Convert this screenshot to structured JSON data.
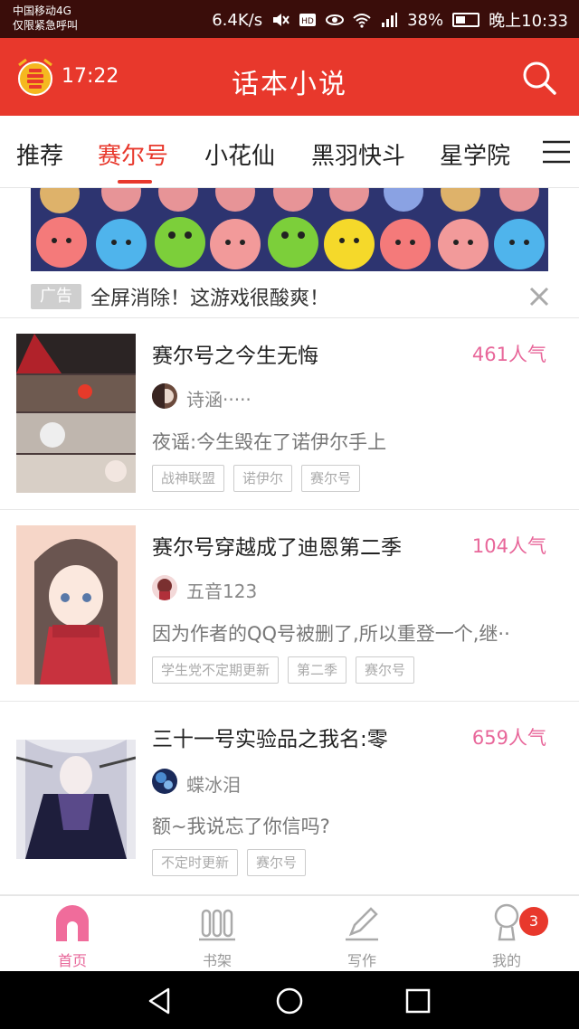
{
  "status_bar": {
    "carrier_line1": "中国移动4G",
    "carrier_line2": "仅限紧急呼叫",
    "net_speed": "6.4K/s",
    "battery": "38%",
    "time": "晚上10:33"
  },
  "header": {
    "timer": "17:22",
    "title": "话本小说",
    "bg_color": "#e8382c"
  },
  "tabs": [
    {
      "label": "推荐",
      "active": false
    },
    {
      "label": "赛尔号",
      "active": true
    },
    {
      "label": "小花仙",
      "active": false
    },
    {
      "label": "黑羽快斗",
      "active": false
    },
    {
      "label": "星学院",
      "active": false
    }
  ],
  "ad": {
    "badge": "广告",
    "text": "全屏消除！这游戏很酸爽！"
  },
  "books": [
    {
      "title": "赛尔号之今生无悔",
      "popularity": "461人气",
      "author": "诗涵·····",
      "description": "夜谣:今生毁在了诺伊尔手上",
      "tags": [
        "战神联盟",
        "诺伊尔",
        "赛尔号"
      ]
    },
    {
      "title": "赛尔号穿越成了迪恩第二季",
      "popularity": "104人气",
      "author": "五音123",
      "description": "因为作者的QQ号被删了,所以重登一个,继··",
      "tags": [
        "学生党不定期更新",
        "第二季",
        "赛尔号"
      ]
    },
    {
      "title": "三十一号实验品之我名:零",
      "popularity": "659人气",
      "author": "蝶冰泪",
      "description": "额~我说忘了你信吗?",
      "tags": [
        "不定时更新",
        "赛尔号"
      ]
    }
  ],
  "bottom_nav": [
    {
      "label": "首页",
      "icon": "home-icon",
      "active": true
    },
    {
      "label": "书架",
      "icon": "bookshelf-icon",
      "active": false
    },
    {
      "label": "写作",
      "icon": "pen-icon",
      "active": false
    },
    {
      "label": "我的",
      "icon": "profile-icon",
      "active": false,
      "badge": "3"
    }
  ],
  "colors": {
    "accent": "#e8382c",
    "popularity": "#e8679a"
  }
}
